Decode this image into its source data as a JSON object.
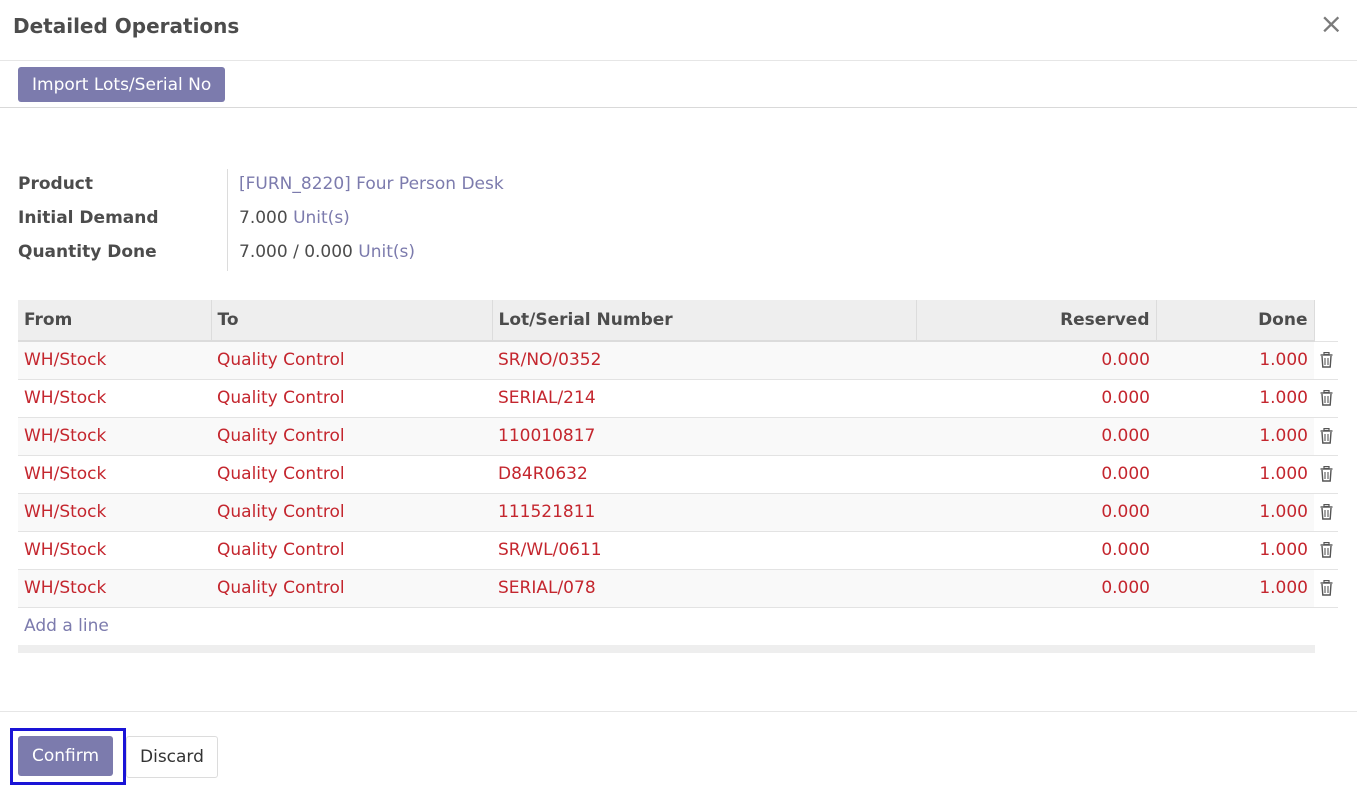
{
  "dialog": {
    "title": "Detailed Operations",
    "close_glyph": "×"
  },
  "toolbar": {
    "import_label": "Import Lots/Serial No"
  },
  "info": {
    "product_label": "Product",
    "product_value": "[FURN_8220] Four Person Desk",
    "initial_demand_label": "Initial Demand",
    "initial_demand_qty": "7.000",
    "initial_demand_uom": "Unit(s)",
    "quantity_done_label": "Quantity Done",
    "quantity_done_qty": "7.000 / 0.000",
    "quantity_done_uom": "Unit(s)"
  },
  "table": {
    "headers": [
      "From",
      "To",
      "Lot/Serial Number",
      "Reserved",
      "Done"
    ],
    "rows": [
      {
        "from": "WH/Stock",
        "to": "Quality Control",
        "lot": "SR/NO/0352",
        "reserved": "0.000",
        "done": "1.000"
      },
      {
        "from": "WH/Stock",
        "to": "Quality Control",
        "lot": "SERIAL/214",
        "reserved": "0.000",
        "done": "1.000"
      },
      {
        "from": "WH/Stock",
        "to": "Quality Control",
        "lot": "110010817",
        "reserved": "0.000",
        "done": "1.000"
      },
      {
        "from": "WH/Stock",
        "to": "Quality Control",
        "lot": "D84R0632",
        "reserved": "0.000",
        "done": "1.000"
      },
      {
        "from": "WH/Stock",
        "to": "Quality Control",
        "lot": "111521811",
        "reserved": "0.000",
        "done": "1.000"
      },
      {
        "from": "WH/Stock",
        "to": "Quality Control",
        "lot": "SR/WL/0611",
        "reserved": "0.000",
        "done": "1.000"
      },
      {
        "from": "WH/Stock",
        "to": "Quality Control",
        "lot": "SERIAL/078",
        "reserved": "0.000",
        "done": "1.000"
      }
    ],
    "add_line_label": "Add a line",
    "row_icon": "trash-icon"
  },
  "footer": {
    "confirm_label": "Confirm",
    "discard_label": "Discard"
  },
  "colors": {
    "accent": "#7c7bad",
    "row_text": "#c4262e",
    "focus_outline": "#1a14d6"
  }
}
